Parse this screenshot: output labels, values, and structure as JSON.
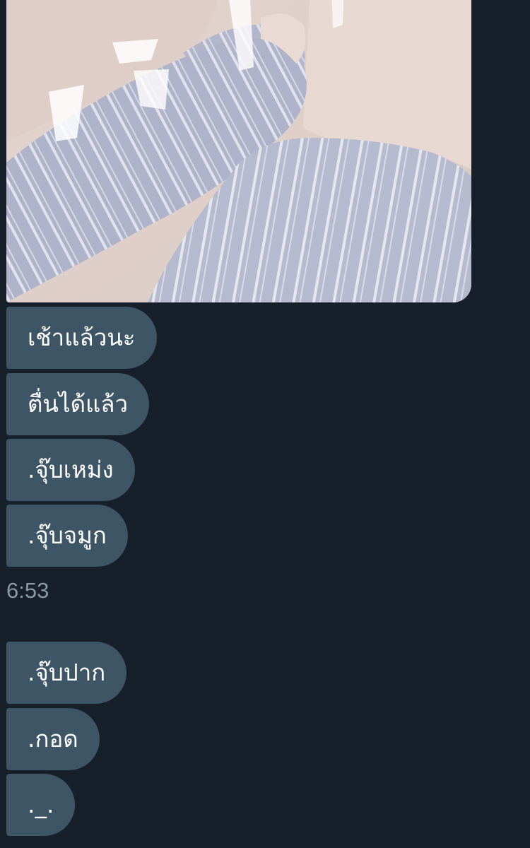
{
  "conversation": {
    "image_message": {
      "alt": ""
    },
    "messages_group1": [
      {
        "text": "เช้าแล้วนะ"
      },
      {
        "text": "ตื่นได้แล้ว"
      },
      {
        "text": ".จุ๊บเหม่ง"
      },
      {
        "text": ".จุ๊บจมูก"
      }
    ],
    "timestamp": "6:53",
    "messages_group2": [
      {
        "text": ".จุ๊บปาก"
      },
      {
        "text": ".กอด"
      },
      {
        "text": "._."
      }
    ]
  },
  "colors": {
    "background": "#17202a",
    "bubble": "#3e5566",
    "bubble_text": "#ffffff",
    "timestamp": "#8b98a5"
  }
}
